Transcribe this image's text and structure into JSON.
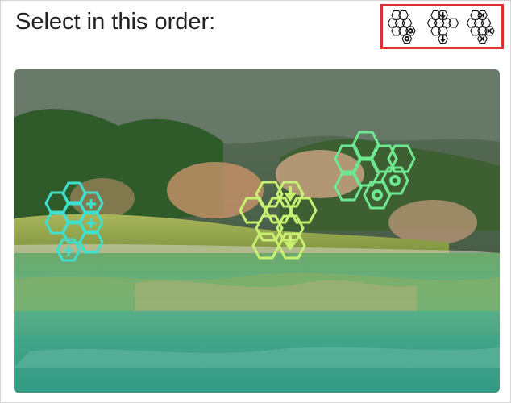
{
  "prompt": {
    "text": "Select in this order:"
  },
  "order_sequence": [
    {
      "id": "target-1",
      "icon": "hex-cluster-gear-icon",
      "marker": "gear"
    },
    {
      "id": "target-2",
      "icon": "hex-cluster-arrow-down-icon",
      "marker": "arrow-down"
    },
    {
      "id": "target-3",
      "icon": "hex-cluster-cross-icon",
      "marker": "cross"
    }
  ],
  "scene": {
    "description_icon": "lake-landscape-image",
    "clusters": [
      {
        "name": "cyan-cross-cluster",
        "marker": "cross",
        "color": "#3fe0d0"
      },
      {
        "name": "lime-arrow-cluster",
        "marker": "arrow-down",
        "color": "#c8f070"
      },
      {
        "name": "green-gear-cluster",
        "marker": "gear",
        "color": "#6ee890"
      }
    ]
  },
  "colors": {
    "highlight_border": "#e03030",
    "text": "#222222"
  }
}
